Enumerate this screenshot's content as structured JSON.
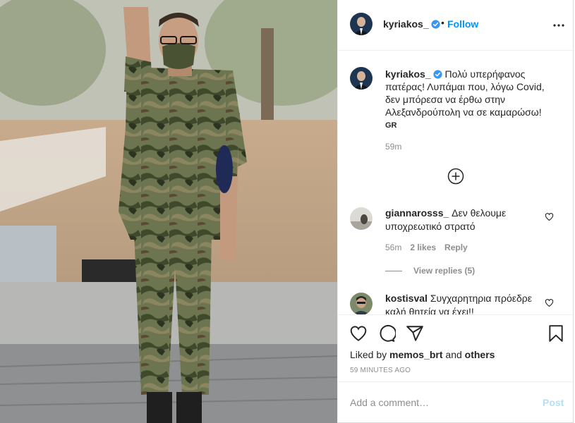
{
  "header": {
    "username": "kyriakos_",
    "separator": "•",
    "follow_label": "Follow",
    "more_icon": "more-options-icon"
  },
  "caption": {
    "username": "kyriakos_",
    "text": "Πολύ υπερήφανος πατέρας! Λυπάμαι που, λόγω Covid, δεν μπόρεσα να έρθω στην Αλεξανδρούπολη να σε καμαρώσω!",
    "translation_tag": "GR",
    "time": "59m"
  },
  "load_more_icon": "plus-circle-icon",
  "comments": [
    {
      "username": "giannarosss_",
      "text": "Δεν θελουμε υποχρεωτικό στρατό",
      "time": "56m",
      "likes": "2 likes",
      "reply_label": "Reply",
      "view_replies": "View replies (5)"
    },
    {
      "username": "kostisval",
      "text": "Συγχαρητηρια πρόεδρε καλή θητεία να έχει!!"
    }
  ],
  "actions": {
    "liked_prefix": "Liked by",
    "liked_user": "memos_brt",
    "liked_and": "and",
    "liked_others": "others",
    "time_ago": "59 MINUTES AGO"
  },
  "add_comment": {
    "placeholder": "Add a comment…",
    "post_label": "Post"
  },
  "colors": {
    "link_blue": "#0095f6",
    "verified_blue": "#3897f0",
    "muted": "#8e8e8e",
    "post_disabled": "#b2dffc"
  }
}
